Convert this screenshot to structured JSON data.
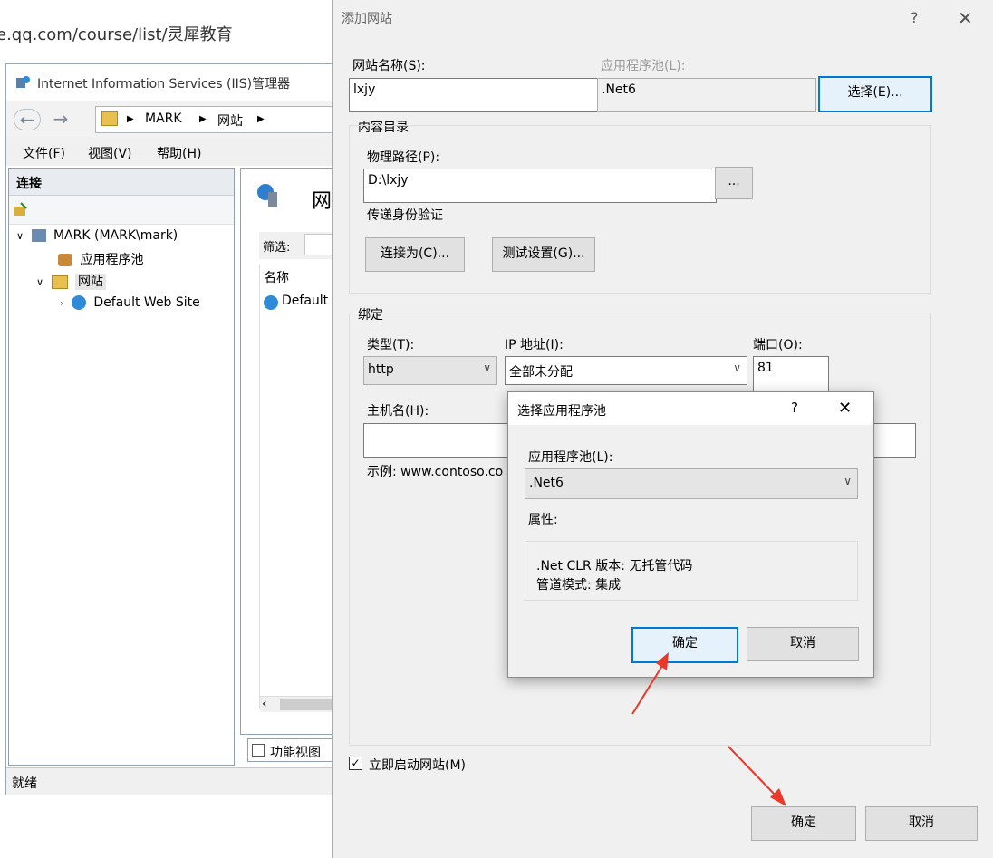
{
  "browser": {
    "url": "e.qq.com/course/list/灵犀教育"
  },
  "iis": {
    "title": "Internet Information Services (IIS)管理器",
    "breadcrumb": [
      "MARK",
      "网站"
    ],
    "menu": [
      "文件(F)",
      "视图(V)",
      "帮助(H)"
    ],
    "connections_header": "连接",
    "tree": {
      "server": "MARK (MARK\\mark)",
      "app_pools": "应用程序池",
      "sites": "网站",
      "default_site": "Default Web Site"
    },
    "content": {
      "heading": "网",
      "filter_label": "筛选:",
      "col_name": "名称",
      "row1": "Default"
    },
    "feature_view": "功能视图",
    "status": "就绪"
  },
  "add_site": {
    "title": "添加网站",
    "help": "?",
    "site_name_label": "网站名称(S):",
    "site_name_value": "lxjy",
    "app_pool_label": "应用程序池(L):",
    "app_pool_value": ".Net6",
    "select_button": "选择(E)...",
    "content_dir_label": "内容目录",
    "physical_path_label": "物理路径(P):",
    "physical_path_value": "D:\\lxjy",
    "browse_button": "...",
    "passthrough_label": "传递身份验证",
    "connect_as_button": "连接为(C)...",
    "test_settings_button": "测试设置(G)...",
    "binding_label": "绑定",
    "type_label": "类型(T):",
    "type_value": "http",
    "ip_label": "IP 地址(I):",
    "ip_value": "全部未分配",
    "port_label": "端口(O):",
    "port_value": "81",
    "host_label": "主机名(H):",
    "host_value": "",
    "example_text": "示例: www.contoso.co",
    "start_site_label": "立即启动网站(M)",
    "start_site_checked": true,
    "ok_button": "确定",
    "cancel_button": "取消"
  },
  "pool_dialog": {
    "title": "选择应用程序池",
    "help": "?",
    "pool_label": "应用程序池(L):",
    "pool_value": ".Net6",
    "properties_label": "属性:",
    "clr_line": ".Net CLR 版本: 无托管代码",
    "pipeline_line": "管道模式: 集成",
    "ok_button": "确定",
    "cancel_button": "取消"
  },
  "colors": {
    "accent": "#0078d7",
    "arrow": "#e8392b"
  }
}
